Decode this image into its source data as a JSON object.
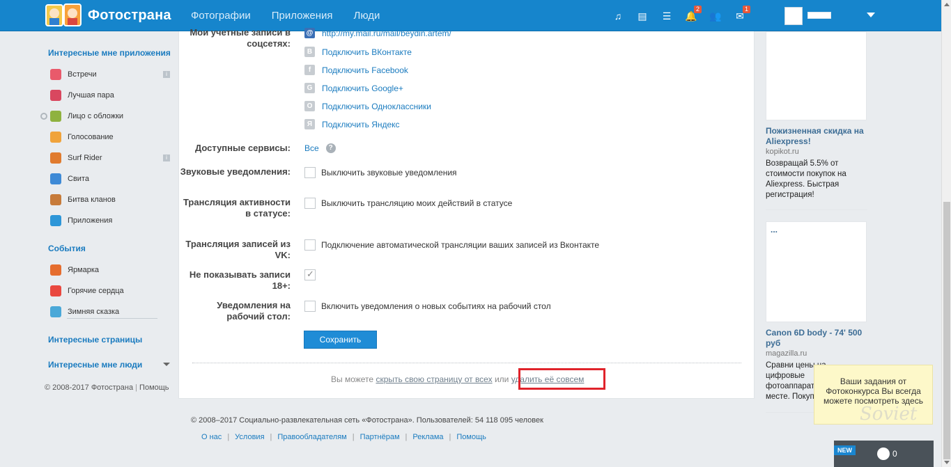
{
  "header": {
    "brand": "Фотострана",
    "nav": [
      "Фотографии",
      "Приложения",
      "Люди"
    ],
    "icons": [
      {
        "name": "music-icon",
        "glyph": "♫",
        "badge": ""
      },
      {
        "name": "feed-icon",
        "glyph": "▤",
        "badge": ""
      },
      {
        "name": "list-icon",
        "glyph": "☰",
        "badge": ""
      },
      {
        "name": "bell-icon",
        "glyph": "🔔",
        "badge": "2"
      },
      {
        "name": "friends-icon",
        "glyph": "👥",
        "badge": ""
      },
      {
        "name": "mail-icon",
        "glyph": "✉",
        "badge": "1"
      }
    ]
  },
  "sidebar": {
    "apps_title": "Интересные мне приложения",
    "apps": [
      {
        "label": "Встречи",
        "color": "#e95a6b",
        "info": "i"
      },
      {
        "label": "Лучшая пара",
        "color": "#d9475f",
        "info": ""
      },
      {
        "label": "Лицо с обложки",
        "color": "#8fb23f",
        "info": ""
      },
      {
        "label": "Голосование",
        "color": "#f0a33b",
        "info": ""
      },
      {
        "label": "Surf Rider",
        "color": "#e07b2f",
        "info": "i"
      },
      {
        "label": "Свита",
        "color": "#3e8ad6",
        "info": ""
      },
      {
        "label": "Битва кланов",
        "color": "#c77b3a",
        "info": ""
      },
      {
        "label": "Приложения",
        "color": "#2d96d8",
        "info": ""
      }
    ],
    "events_title": "События",
    "events": [
      {
        "label": "Ярмарка",
        "color": "#e56d2e"
      },
      {
        "label": "Горячие сердца",
        "color": "#e9483f"
      },
      {
        "label": "Зимняя сказка",
        "color": "#4aa8d8"
      }
    ],
    "pages_title": "Интересные страницы",
    "people_title": "Интересные мне люди",
    "copyright": "© 2008-2017 Фотострана",
    "help": "Помощь"
  },
  "settings": {
    "accounts_label": "Мои учетные записи в соцсетях:",
    "mail_link": "http://my.mail.ru/mail/beydin.artem/",
    "social": [
      {
        "icon": "vk-icon",
        "glyph": "В",
        "label": "Подключить ВКонтакте"
      },
      {
        "icon": "facebook-icon",
        "glyph": "f",
        "label": "Подключить Facebook"
      },
      {
        "icon": "google-plus-icon",
        "glyph": "G",
        "label": "Подключить Google+"
      },
      {
        "icon": "odnoklassniki-icon",
        "glyph": "О",
        "label": "Подключить Одноклассники"
      },
      {
        "icon": "yandex-icon",
        "glyph": "Я",
        "label": "Подключить Яндекс"
      }
    ],
    "services_label": "Доступные сервисы:",
    "services_value": "Все",
    "sound_label": "Звуковые уведомления:",
    "sound_option": "Выключить звуковые уведомления",
    "activity_label": "Трансляция активности в статусе:",
    "activity_option": "Выключить трансляцию моих действий в статусе",
    "vk_label": "Трансляция записей из VK:",
    "vk_option": "Подключение автоматической трансляции ваших записей из Вконтакте",
    "adult_label": "Не показывать записи 18+:",
    "desktop_label": "Уведомления на рабочий стол:",
    "desktop_option": "Включить уведомления о новых событиях на рабочий стол",
    "save": "Сохранить",
    "bottom_prefix": "Вы можете",
    "hide_link": "скрыть свою страницу от всех",
    "bottom_or": "или",
    "delete_link": "удалить её совсем"
  },
  "footer": {
    "copyright": "© 2008–2017 Социально-развлекательная сеть «Фотострана». Пользователей: 54 118 095 человек",
    "links": [
      "О нас",
      "Условия",
      "Правообладателям",
      "Партнёрам",
      "Реклама",
      "Помощь"
    ]
  },
  "ads": [
    {
      "title": "Пожизненная скидка на Aliexpress!",
      "source": "kopikot.ru",
      "text": "Возвращай 5.5% от стоимости покупок на Aliexpress. Быстрая регистрация!"
    },
    {
      "title": "Canon 6D body - 74' 500 руб",
      "source": "magazilla.ru",
      "text": "Сравни цены на цифровые фотоаппараты в одном месте. Покупай"
    }
  ],
  "ad_placeholder": "...",
  "toast": "Ваши задания от Фотоконкурса Вы всегда можете посмотреть здесь",
  "chat": {
    "new": "NEW",
    "count": "0"
  }
}
